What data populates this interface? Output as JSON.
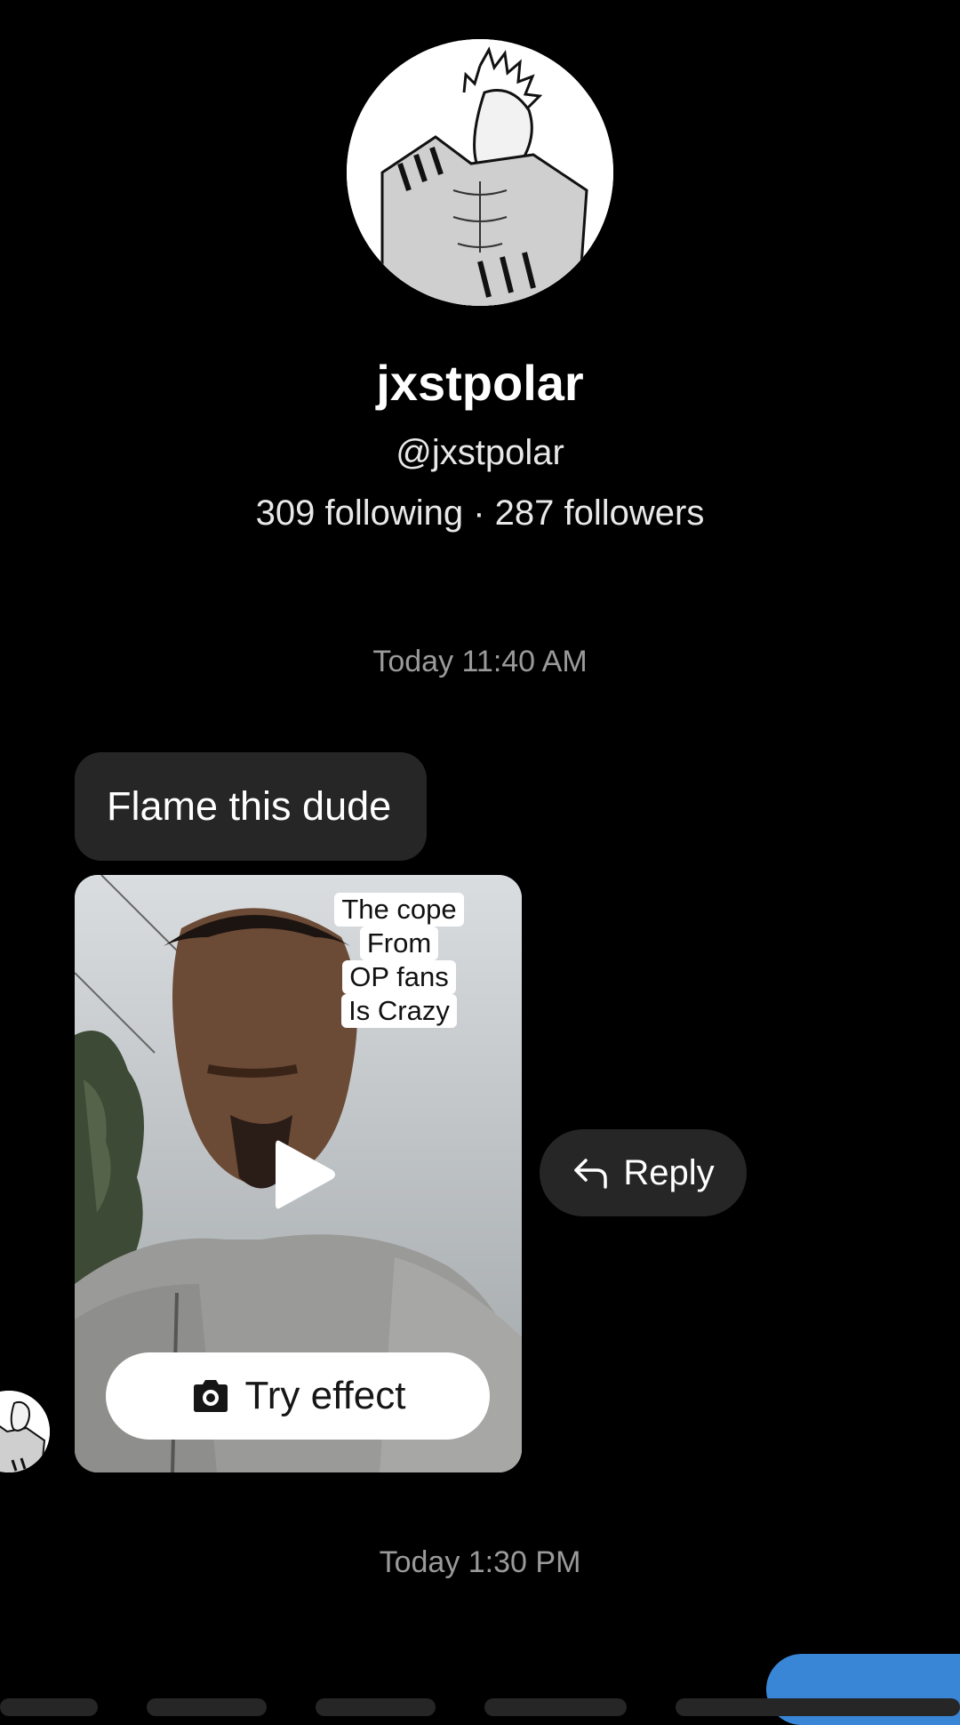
{
  "profile": {
    "display_name": "jxstpolar",
    "handle": "@jxstpolar",
    "stats": "309 following · 287 followers",
    "avatar_icon": "manga-character-avatar"
  },
  "conversation": {
    "timestamp_1": "Today 11:40 AM",
    "message_text": "Flame this dude",
    "shared_video": {
      "caption_lines": [
        "The cope",
        "From",
        "OP fans",
        "Is Crazy"
      ],
      "play_icon": "play-icon",
      "try_effect_label": "Try effect",
      "try_effect_icon": "camera-icon"
    },
    "reply_label": "Reply",
    "reply_icon": "reply-arrow-icon",
    "timestamp_2": "Today 1:30 PM"
  },
  "colors": {
    "background": "#000000",
    "bubble": "#262626",
    "timestamp": "#9a9a9a",
    "outgoing_bubble": "#3a86d6"
  }
}
